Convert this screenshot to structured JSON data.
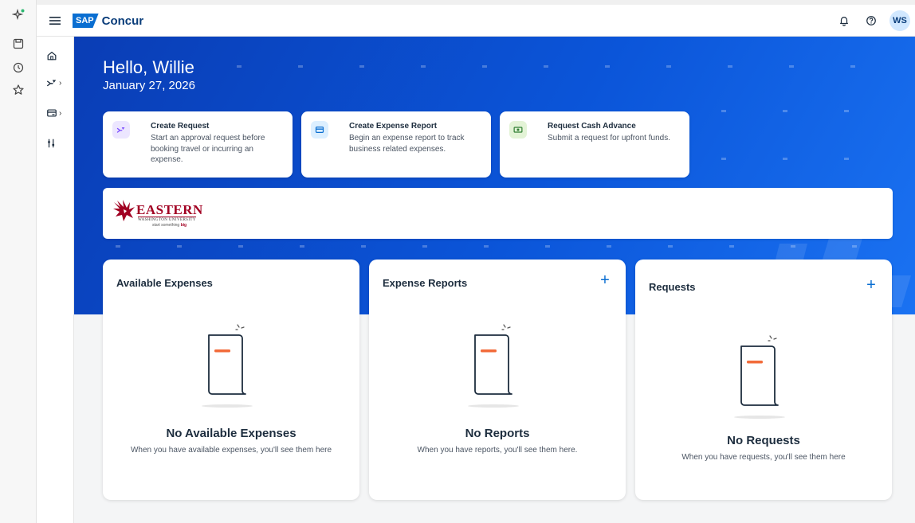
{
  "rail": {
    "icons": [
      "sparkle-icon",
      "save-page-icon",
      "history-icon",
      "favorites-star-icon"
    ]
  },
  "topbar": {
    "logo_sap": "SAP",
    "logo_concur": "Concur",
    "user_initials": "WS",
    "icons": [
      "hamburger-menu-icon",
      "notifications-bell-icon",
      "help-icon"
    ]
  },
  "sidenav": {
    "items": [
      "home-icon",
      "travel-request-icon",
      "expense-icon",
      "settings-sliders-icon"
    ],
    "expand_chevron": "›"
  },
  "hero": {
    "greeting": "Hello, Willie",
    "date": "January 27, 2026",
    "actions": [
      {
        "title": "Create Request",
        "description": "Start an approval request before booking travel or incurring an expense.",
        "icon": "request-icon",
        "icon_bg": "#ece6ff",
        "icon_color": "#7c4dff"
      },
      {
        "title": "Create Expense Report",
        "description": "Begin an expense report to track business related expenses.",
        "icon": "expense-card-icon",
        "icon_bg": "#dcefff",
        "icon_color": "#0a6ed1"
      },
      {
        "title": "Request Cash Advance",
        "description": "Submit a request for upfront funds.",
        "icon": "cash-icon",
        "icon_bg": "#e3f3d6",
        "icon_color": "#2e7d32"
      }
    ]
  },
  "banner": {
    "name": "EASTERN",
    "subtitle": "WASHINGTON UNIVERSITY",
    "tagline_prefix": "start something ",
    "tagline_emph": "big"
  },
  "tiles": [
    {
      "title": "Available Expenses",
      "has_add": false,
      "empty_title": "No Available Expenses",
      "empty_desc": "When you have available expenses, you'll see them here"
    },
    {
      "title": "Expense Reports",
      "has_add": true,
      "add_label": "+",
      "empty_title": "No Reports",
      "empty_desc": "When you have reports, you'll see them here."
    },
    {
      "title": "Requests",
      "has_add": true,
      "add_label": "+",
      "empty_title": "No Requests",
      "empty_desc": "When you have requests, you'll see them here"
    }
  ],
  "colors": {
    "brand_blue": "#0a6ed1",
    "hero_gradient_start": "#0a3db5",
    "hero_gradient_end": "#1a72f2",
    "illustration_accent": "#f26b3a",
    "ewu_red": "#a10022"
  }
}
